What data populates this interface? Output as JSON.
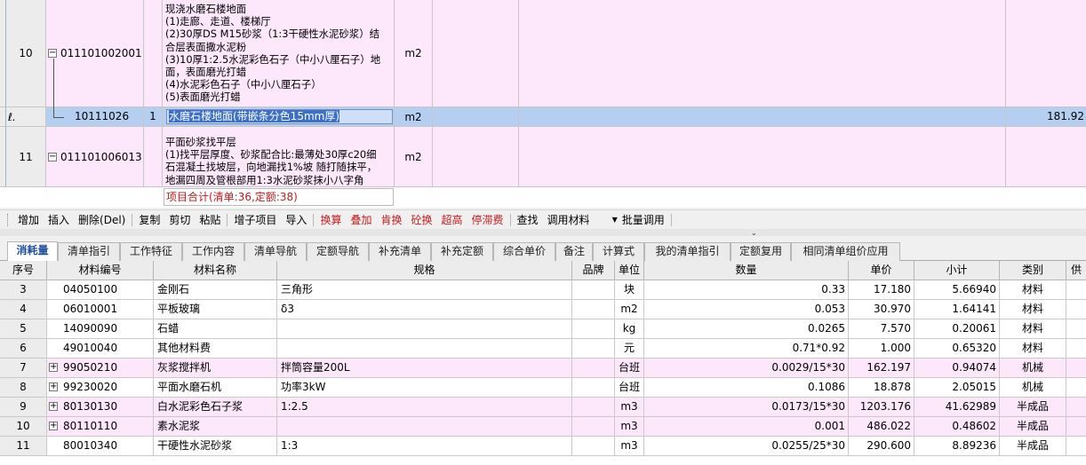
{
  "upper": {
    "rows": [
      {
        "num": "10",
        "code": "011101002001",
        "index": "",
        "desc_lines": [
          "现浇水磨石楼地面",
          "(1)走廊、走道、楼梯厅",
          "(2)30厚DS M15砂浆（1:3干硬性水泥砂浆）结",
          "合层表面撒水泥粉",
          "(3)10厚1:2.5水泥彩色石子（中小八厘石子）地",
          "面，表面磨光打蜡",
          "(4)水泥彩色石子（中小八厘石子）",
          "(5)表面磨光打蜡"
        ],
        "unit": "m2"
      },
      {
        "num": "",
        "code": "10111026",
        "index": "1",
        "desc": "水磨石楼地面(带嵌条分色15mm厚)",
        "unit": "m2",
        "amount": "181.92"
      },
      {
        "num": "11",
        "code": "011101006013",
        "index": "",
        "desc_lines": [
          "平面砂浆找平层",
          "(1)找平层厚度、砂浆配合比:最薄处30厚c20细",
          "石混凝土找坡层，向地漏找1%坡 随打随抹平，",
          "地漏四周及管根部用1:3水泥砂浆抹小八字角"
        ],
        "unit": "m2"
      }
    ],
    "total_line": "项目合计(清单:36,定额:38)"
  },
  "toolbar": {
    "groups": [
      [
        {
          "label": "增加"
        },
        {
          "label": "插入"
        },
        {
          "label": "删除(Del)"
        }
      ],
      [
        {
          "label": "复制"
        },
        {
          "label": "剪切"
        },
        {
          "label": "粘贴"
        }
      ],
      [
        {
          "label": "增子项目"
        },
        {
          "label": "导入"
        }
      ],
      [
        {
          "label": "换算",
          "red": true
        },
        {
          "label": "叠加",
          "red": true
        },
        {
          "label": "肯换",
          "red": true
        },
        {
          "label": "砼换",
          "red": true
        },
        {
          "label": "超高",
          "red": true
        },
        {
          "label": "停滞费",
          "red": true
        }
      ],
      [
        {
          "label": "查找"
        },
        {
          "label": "调用材料"
        }
      ]
    ],
    "batch_label": "批量调用"
  },
  "tabs": [
    "消耗量",
    "清单指引",
    "工作特征",
    "工作内容",
    "清单导航",
    "定额导航",
    "补充清单",
    "补充定额",
    "综合单价",
    "备注",
    "计算式",
    "我的清单指引",
    "定额复用",
    "相同清单组价应用"
  ],
  "active_tab": 0,
  "table": {
    "headers": [
      "序号",
      "材料编号",
      "材料名称",
      "规格",
      "品牌",
      "单位",
      "数量",
      "单价",
      "小计",
      "类别",
      "供"
    ],
    "rows": [
      {
        "seq": "3",
        "code": "04050100",
        "name": "金刚石",
        "spec": "三角形",
        "brand": "",
        "unit": "块",
        "qty": "0.33",
        "price": "17.180",
        "subtotal": "5.66940",
        "type": "材料",
        "pink": false,
        "expandable": false
      },
      {
        "seq": "4",
        "code": "06010001",
        "name": "平板玻璃",
        "spec": "δ3",
        "brand": "",
        "unit": "m2",
        "qty": "0.053",
        "price": "30.970",
        "subtotal": "1.64141",
        "type": "材料",
        "pink": false,
        "expandable": false
      },
      {
        "seq": "5",
        "code": "14090090",
        "name": "石蜡",
        "spec": "",
        "brand": "",
        "unit": "kg",
        "qty": "0.0265",
        "price": "7.570",
        "subtotal": "0.20061",
        "type": "材料",
        "pink": false,
        "expandable": false
      },
      {
        "seq": "6",
        "code": "49010040",
        "name": "其他材料费",
        "spec": "",
        "brand": "",
        "unit": "元",
        "qty": "0.71*0.92",
        "price": "1.000",
        "subtotal": "0.65320",
        "type": "材料",
        "pink": false,
        "expandable": false
      },
      {
        "seq": "7",
        "code": "99050210",
        "name": "灰浆搅拌机",
        "spec": "拌筒容量200L",
        "brand": "",
        "unit": "台班",
        "qty": "0.0029/15*30",
        "price": "162.197",
        "subtotal": "0.94074",
        "type": "机械",
        "pink": true,
        "expandable": true
      },
      {
        "seq": "8",
        "code": "99230020",
        "name": "平面水磨石机",
        "spec": "功率3kW",
        "brand": "",
        "unit": "台班",
        "qty": "0.1086",
        "price": "18.878",
        "subtotal": "2.05015",
        "type": "机械",
        "pink": false,
        "expandable": true
      },
      {
        "seq": "9",
        "code": "80130130",
        "name": "白水泥彩色石子浆",
        "spec": "1:2.5",
        "brand": "",
        "unit": "m3",
        "qty": "0.0173/15*30",
        "price": "1203.176",
        "subtotal": "41.62989",
        "type": "半成品",
        "pink": true,
        "expandable": true
      },
      {
        "seq": "10",
        "code": "80110110",
        "name": "素水泥浆",
        "spec": "",
        "brand": "",
        "unit": "m3",
        "qty": "0.001",
        "price": "486.022",
        "subtotal": "0.48602",
        "type": "半成品",
        "pink": true,
        "expandable": true
      },
      {
        "seq": "11",
        "code": "80010340",
        "name": "干硬性水泥砂浆",
        "spec": "1:3",
        "brand": "",
        "unit": "m3",
        "qty": "0.0255/25*30",
        "price": "290.600",
        "subtotal": "8.89236",
        "type": "半成品",
        "pink": false,
        "expandable": false
      }
    ]
  },
  "colors": {
    "pink_row": "#fce7fb",
    "selected_row": "#b4cff0",
    "toolbar_red": "#c51b1b",
    "total_text": "#c21a1a"
  }
}
